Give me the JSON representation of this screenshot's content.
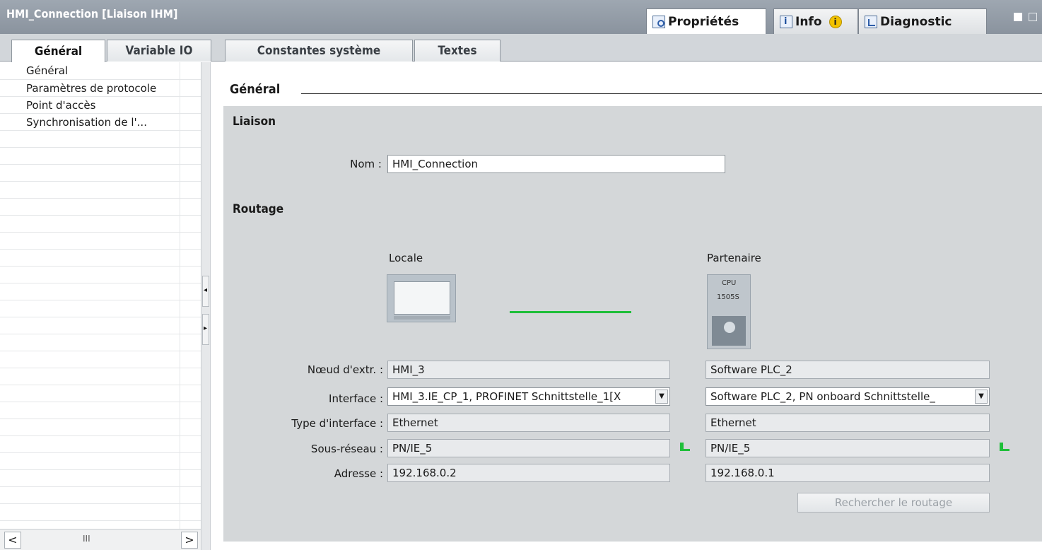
{
  "window": {
    "title": "HMI_Connection [Liaison IHM]",
    "panel_tabs": [
      {
        "label": "Propriétés",
        "icon": "properties-icon",
        "active": true
      },
      {
        "label": "Info",
        "icon": "info-icon",
        "badge": "i",
        "active": false
      },
      {
        "label": "Diagnostic",
        "icon": "diagnostic-icon",
        "active": false
      }
    ]
  },
  "tabs": [
    {
      "label": "Général",
      "active": true
    },
    {
      "label": "Variable IO",
      "active": false
    },
    {
      "label": "Constantes système",
      "active": false
    },
    {
      "label": "Textes",
      "active": false
    }
  ],
  "nav": {
    "items": [
      {
        "label": "Général",
        "selected": true
      },
      {
        "label": "Paramètres de protocole"
      },
      {
        "label": "Point d'accès"
      },
      {
        "label": "Synchronisation de l'..."
      }
    ],
    "scroll_thumb": "III"
  },
  "content": {
    "section_title": "Général",
    "liaison": {
      "title": "Liaison",
      "name_label": "Nom :",
      "name_value": "HMI_Connection"
    },
    "routage": {
      "title": "Routage",
      "local_label": "Locale",
      "partner_label": "Partenaire",
      "cpu_text_1": "CPU",
      "cpu_text_2": "1505S",
      "fields": {
        "end_node_label": "Nœud d'extr. :",
        "interface_label": "Interface :",
        "interface_type_label": "Type d'interface :",
        "subnet_label": "Sous-réseau :",
        "address_label": "Adresse :"
      },
      "local": {
        "end_node": "HMI_3",
        "interface": "HMI_3.IE_CP_1, PROFINET Schnittstelle_1[X",
        "interface_type": "Ethernet",
        "subnet": "PN/IE_5",
        "address": "192.168.0.2"
      },
      "partner": {
        "end_node": "Software PLC_2",
        "interface": "Software PLC_2, PN onboard Schnittstelle_",
        "interface_type": "Ethernet",
        "subnet": "PN/IE_5",
        "address": "192.168.0.1"
      },
      "search_button": "Rechercher le routage"
    }
  },
  "colors": {
    "titlebar": "#9ea7b1",
    "panel_bg": "#d4d7d9",
    "connection_green": "#1fbf3a"
  }
}
